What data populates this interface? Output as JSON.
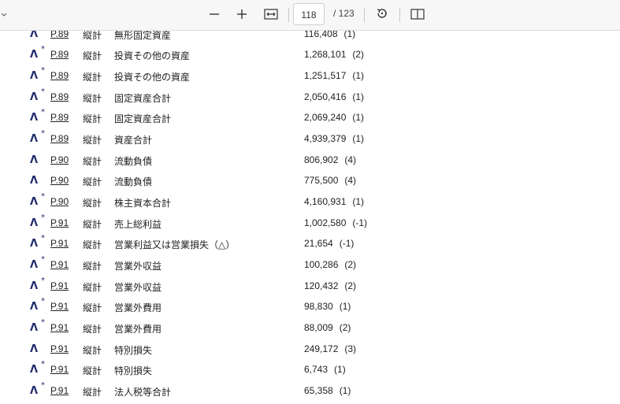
{
  "toolbar": {
    "current_page": "118",
    "total_pages": "/ 123",
    "icons": [
      "chevron-down-icon",
      "zoom-out-icon",
      "zoom-in-icon",
      "fit-width-icon",
      "rotate-icon",
      "page-view-icon"
    ]
  },
  "rows": [
    {
      "star": "",
      "page": "P.89",
      "kind": "縦計",
      "label": "無形固定資産",
      "value": "116,408",
      "count": "(1)"
    },
    {
      "star": "*",
      "page": "P.89",
      "kind": "縦計",
      "label": "投資その他の資産",
      "value": "1,268,101",
      "count": "(2)"
    },
    {
      "star": "*",
      "page": "P.89",
      "kind": "縦計",
      "label": "投資その他の資産",
      "value": "1,251,517",
      "count": "(1)"
    },
    {
      "star": "*",
      "page": "P.89",
      "kind": "縦計",
      "label": "固定資産合計",
      "value": "2,050,416",
      "count": "(1)"
    },
    {
      "star": "*",
      "page": "P.89",
      "kind": "縦計",
      "label": "固定資産合計",
      "value": "2,069,240",
      "count": "(1)"
    },
    {
      "star": "*",
      "page": "P.89",
      "kind": "縦計",
      "label": "資産合計",
      "value": "4,939,379",
      "count": "(1)"
    },
    {
      "star": "",
      "page": "P.90",
      "kind": "縦計",
      "label": "流動負債",
      "value": "806,902",
      "count": "(4)"
    },
    {
      "star": "",
      "page": "P.90",
      "kind": "縦計",
      "label": "流動負債",
      "value": "775,500",
      "count": "(4)"
    },
    {
      "star": "*",
      "page": "P.90",
      "kind": "縦計",
      "label": "株主資本合計",
      "value": "4,160,931",
      "count": "(1)"
    },
    {
      "star": "*",
      "page": "P.91",
      "kind": "縦計",
      "label": "売上総利益",
      "value": "1,002,580",
      "count": "(-1)"
    },
    {
      "star": "*",
      "page": "P.91",
      "kind": "縦計",
      "label": "営業利益又は営業損失（△）",
      "value": "21,654",
      "count": "(-1)"
    },
    {
      "star": "*",
      "page": "P.91",
      "kind": "縦計",
      "label": "営業外収益",
      "value": "100,286",
      "count": "(2)"
    },
    {
      "star": "*",
      "page": "P.91",
      "kind": "縦計",
      "label": "営業外収益",
      "value": "120,432",
      "count": "(2)"
    },
    {
      "star": "*",
      "page": "P.91",
      "kind": "縦計",
      "label": "営業外費用",
      "value": "98,830",
      "count": "(1)"
    },
    {
      "star": "*",
      "page": "P.91",
      "kind": "縦計",
      "label": "営業外費用",
      "value": "88,009",
      "count": "(2)"
    },
    {
      "star": "",
      "page": "P.91",
      "kind": "縦計",
      "label": "特別損失",
      "value": "249,172",
      "count": "(3)"
    },
    {
      "star": "*",
      "page": "P.91",
      "kind": "縦計",
      "label": "特別損失",
      "value": "6,743",
      "count": "(1)"
    },
    {
      "star": "*",
      "page": "P.91",
      "kind": "縦計",
      "label": "法人税等合計",
      "value": "65,358",
      "count": "(1)"
    }
  ]
}
